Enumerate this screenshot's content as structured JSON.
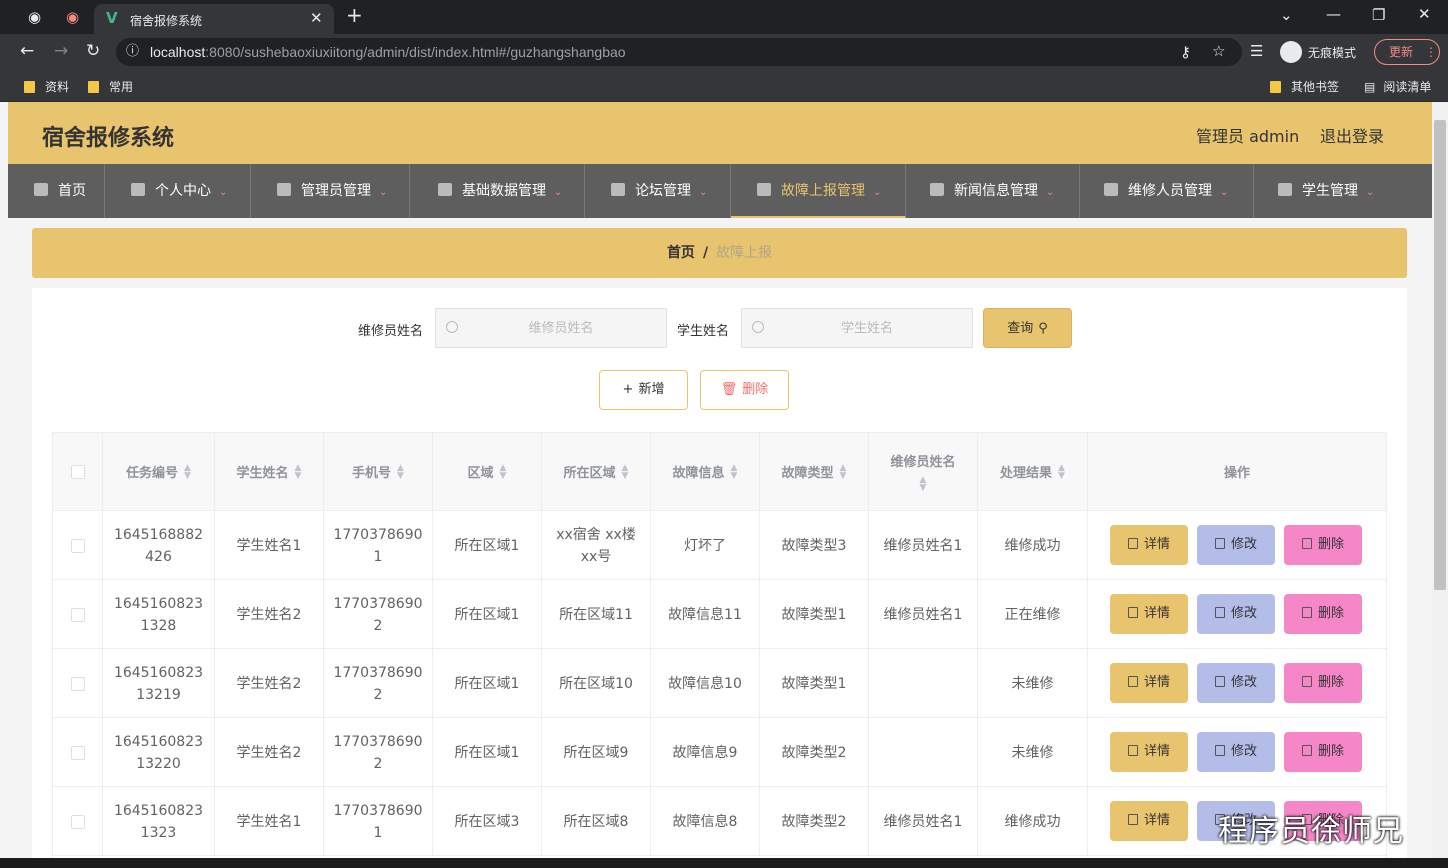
{
  "browser": {
    "tab_title": "宿舍报修系统",
    "url_host": "localhost",
    "url_rest": ":8080/sushebaoxiuxiitong/admin/dist/index.html#/guzhangshangbao",
    "incognito_label": "无痕模式",
    "update_label": "更新",
    "bookmarks": [
      "资料",
      "常用"
    ],
    "other_bookmarks": "其他书签",
    "reading_list": "阅读清单"
  },
  "header": {
    "title": "宿舍报修系统",
    "user": "管理员 admin",
    "logout": "退出登录"
  },
  "nav": [
    {
      "label": "首页",
      "icon": "home-icon"
    },
    {
      "label": "个人中心",
      "icon": "user-icon"
    },
    {
      "label": "管理员管理",
      "icon": "send-icon"
    },
    {
      "label": "基础数据管理",
      "icon": "shop-icon"
    },
    {
      "label": "论坛管理",
      "icon": "clipboard-icon"
    },
    {
      "label": "故障上报管理",
      "icon": "monitor-icon"
    },
    {
      "label": "新闻信息管理",
      "icon": "globe-icon"
    },
    {
      "label": "维修人员管理",
      "icon": "power-icon"
    },
    {
      "label": "学生管理",
      "icon": "target-icon"
    }
  ],
  "breadcrumb": {
    "home": "首页",
    "separator": "/",
    "current": "故障上报"
  },
  "search": {
    "repair_label": "维修员姓名",
    "repair_placeholder": "维修员姓名",
    "student_label": "学生姓名",
    "student_placeholder": "学生姓名",
    "query_button": "查询"
  },
  "toolbar": {
    "add": "新增",
    "delete": "删除"
  },
  "table": {
    "headers": [
      "任务编号",
      "学生姓名",
      "手机号",
      "区域",
      "所在区域",
      "故障信息",
      "故障类型",
      "维修员姓名",
      "处理结果",
      "操作"
    ],
    "actions": {
      "detail": "详情",
      "edit": "修改",
      "delete": "删除"
    },
    "rows": [
      [
        "1645168882426",
        "学生姓名1",
        "17703786901",
        "所在区域1",
        "xx宿舍 xx楼 xx号",
        "灯坏了",
        "故障类型3",
        "维修员姓名1",
        "维修成功"
      ],
      [
        "16451608231328",
        "学生姓名2",
        "17703786902",
        "所在区域1",
        "所在区域11",
        "故障信息11",
        "故障类型1",
        "维修员姓名1",
        "正在维修"
      ],
      [
        "164516082313219",
        "学生姓名2",
        "17703786902",
        "所在区域1",
        "所在区域10",
        "故障信息10",
        "故障类型1",
        "",
        "未维修"
      ],
      [
        "164516082313220",
        "学生姓名2",
        "17703786902",
        "所在区域1",
        "所在区域9",
        "故障信息9",
        "故障类型2",
        "",
        "未维修"
      ],
      [
        "16451608231323",
        "学生姓名1",
        "17703786901",
        "所在区域3",
        "所在区域8",
        "故障信息8",
        "故障类型2",
        "维修员姓名1",
        "维修成功"
      ]
    ]
  },
  "watermark": "程序员徐师兄",
  "colors": {
    "accent": "#e8c46e",
    "nav_bg": "#5f5e5e",
    "edit_btn": "#b4bde8",
    "delete_btn": "#f586c8"
  }
}
